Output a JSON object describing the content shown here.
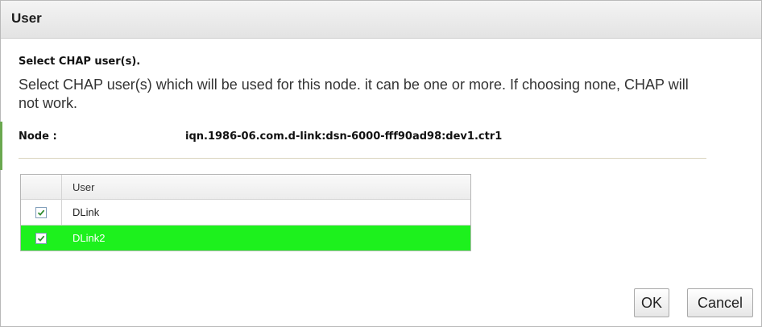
{
  "dialog": {
    "title": "User",
    "heading": "Select CHAP user(s).",
    "description": "Select CHAP user(s) which will be used for this node. it can be one or more. If choosing none, CHAP will not work.",
    "node_label": "Node :",
    "node_value": "iqn.1986-06.com.d-link:dsn-6000-fff90ad98:dev1.ctr1"
  },
  "grid": {
    "column_user": "User",
    "rows": [
      {
        "name": "DLink",
        "checked": true,
        "selected": false
      },
      {
        "name": "DLink2",
        "checked": true,
        "selected": true
      }
    ]
  },
  "buttons": {
    "ok": "OK",
    "cancel": "Cancel"
  },
  "colors": {
    "selected_row": "#1df11d",
    "check_mark": "#2e8b2e"
  }
}
